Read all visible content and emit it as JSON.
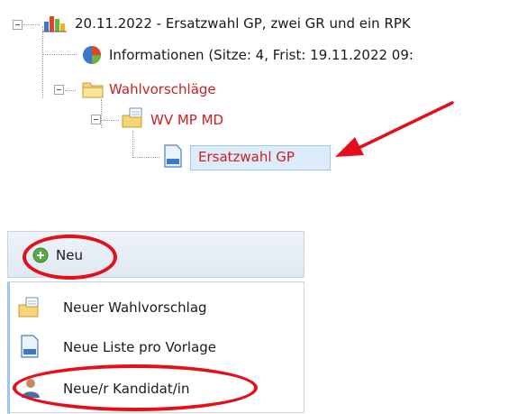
{
  "tree": {
    "root": {
      "label": "20.11.2022 - Ersatzwahl GP, zwei GR und ein RPK",
      "icon": "bar-chart-icon"
    },
    "info": {
      "label": "Informationen (Sitze: 4, Frist: 19.11.2022 09:",
      "icon": "pie-chart-icon"
    },
    "folder": {
      "label": "Wahlvorschläge",
      "icon": "folder-icon"
    },
    "subfolder": {
      "label": "WV MP MD",
      "icon": "folder-document-icon"
    },
    "leaf": {
      "label": "Ersatzwahl GP",
      "icon": "document-icon",
      "selected": true
    }
  },
  "menu": {
    "header": {
      "label": "Neu",
      "icon": "add-icon"
    },
    "items": [
      {
        "label": "Neuer Wahlvorschlag",
        "icon": "folder-document-icon"
      },
      {
        "label": "Neue Liste pro Vorlage",
        "icon": "document-icon"
      },
      {
        "label": "Neue/r Kandidat/in",
        "icon": "user-icon"
      }
    ]
  },
  "colors": {
    "accent_red": "#cc1f1f",
    "annotation_red": "#e3101b",
    "selection_bg": "#dcecfb"
  }
}
